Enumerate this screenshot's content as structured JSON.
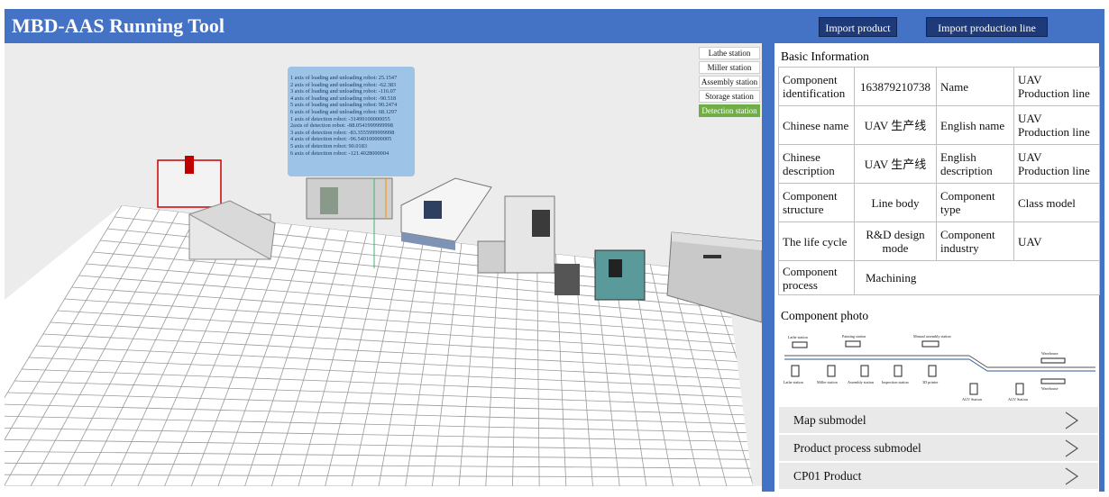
{
  "app": {
    "title": "MBD-AAS Running Tool",
    "import_product": "Import product",
    "import_line": "Import production line"
  },
  "viewport": {
    "stations": [
      {
        "label": "Lathe station",
        "active": false
      },
      {
        "label": "Miller station",
        "active": false
      },
      {
        "label": "Assembly station",
        "active": false
      },
      {
        "label": "Storage station",
        "active": false
      },
      {
        "label": "Detection station",
        "active": true
      }
    ],
    "robot_readout": [
      "1 axis of loading and unloading robot: 25.1547",
      "2 axis of loading and unloading robot: -62.383",
      "3 axis of loading and unloading robot: -116.07",
      "4 axis of loading and unloading robot: -90.518",
      "5 axis of loading and unloading robot: 90.2474",
      "6 axis of loading and unloading robot: 68.1297",
      "1 axis of detection robot: -31499100000055",
      "2axis of detection robot: -88.0541999999998",
      "3 axis of detection robot: -83.3555999999998",
      "4 axis of detection robot: -96.540100000005",
      "5 axis of detection robot: 90.0183",
      "6 axis of detection  robot: -121.4028000004"
    ]
  },
  "info": {
    "basic_title": "Basic  Information",
    "rows": [
      {
        "k1": "Component identification",
        "v1": "163879210738",
        "k2": "Name",
        "v2": "UAV Production  line"
      },
      {
        "k1": "Chinese name",
        "v1": "UAV 生产线",
        "k2": "English name",
        "v2": "UAV Production  line"
      },
      {
        "k1": "Chinese description",
        "v1": "UAV 生产线",
        "k2": "English description",
        "v2": "UAV Production  line"
      },
      {
        "k1": "Component structure",
        "v1": "Line  body",
        "k2": "Component type",
        "v2": "Class model"
      },
      {
        "k1": "The life  cycle",
        "v1": "R&D design mode",
        "k2": "Component industry",
        "v2": "UAV"
      }
    ],
    "process_key": "Component process",
    "process_val": "Machining",
    "photo_title": "Component  photo",
    "photo_labels": {
      "top": [
        "Lathe station",
        "Painting station",
        "Manual assembly station"
      ],
      "bottom": [
        "Lathe station",
        "Miller station",
        "Assembly station",
        "Inspection station",
        "3D printer"
      ],
      "agv": [
        "AGV Station",
        "AGV Station"
      ],
      "warehouse": [
        "Warehouse",
        "Warehouse"
      ]
    },
    "submodels": [
      "Map submodel",
      "Product process  submodel",
      "CP01 Product"
    ]
  }
}
